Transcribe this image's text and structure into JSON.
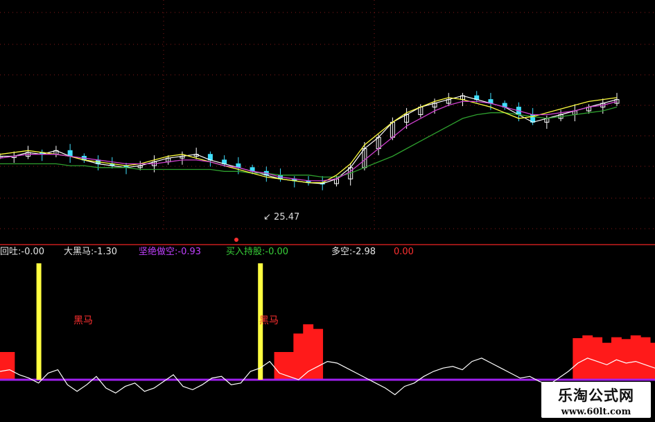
{
  "price_low_label": "25.47",
  "indicators": [
    {
      "label": "回吐:",
      "value": "-0.00",
      "color": "#e6e6e6"
    },
    {
      "label": "大黑马:",
      "value": "-1.30",
      "color": "#e6e6e6"
    },
    {
      "label": "坚绝做空:",
      "value": "-0.93",
      "color": "#c040ff"
    },
    {
      "label": "买入持股:",
      "value": "-0.00",
      "color": "#38d038"
    },
    {
      "label": "多空:",
      "value": "-2.98",
      "color": "#e6e6e6"
    },
    {
      "label": "",
      "value": "0.00",
      "color": "#ff3030"
    }
  ],
  "markers": [
    {
      "text": "黑马"
    },
    {
      "text": "黑马"
    }
  ],
  "watermark": {
    "text": "乐淘公式网",
    "url": "www.60lt.com"
  },
  "colors": {
    "bg": "#000000",
    "red": "#ff1a1a",
    "yellow": "#ffff40",
    "purple": "#a020f0",
    "green": "#2ea02e",
    "grid": "#8a1a1a"
  },
  "chart_data": [
    {
      "type": "line",
      "subtype": "candlestick-with-moving-averages",
      "title": "",
      "annotations": [
        "25.47"
      ],
      "grid": true,
      "series": [
        {
          "values": [
            40,
            40,
            42,
            41,
            43,
            40,
            38,
            36,
            35,
            34,
            35,
            37,
            39,
            40,
            41,
            38,
            36,
            34,
            32,
            30,
            28,
            27,
            26,
            25.5,
            28,
            34,
            44,
            50,
            58,
            62,
            66,
            68,
            70,
            72,
            70,
            68,
            66,
            62,
            58,
            60,
            62,
            64,
            66,
            68,
            70
          ]
        },
        {
          "values": [
            36,
            36,
            36,
            36,
            36,
            35,
            35,
            34,
            34,
            34,
            33,
            33,
            33,
            33,
            33,
            33,
            32,
            32,
            31,
            31,
            30,
            30,
            30,
            29,
            29,
            31,
            34,
            37,
            40,
            44,
            48,
            52,
            56,
            60,
            62,
            63,
            63,
            62,
            61,
            60,
            61,
            62,
            63,
            64,
            66
          ]
        },
        {
          "values": [
            41,
            42,
            43,
            42,
            41,
            40,
            38,
            37,
            36,
            35,
            36,
            38,
            40,
            41,
            39,
            37,
            35,
            33,
            31,
            29,
            28,
            27,
            26,
            26,
            30,
            36,
            46,
            52,
            58,
            63,
            66,
            69,
            71,
            70,
            68,
            66,
            63,
            60,
            61,
            63,
            65,
            67,
            69,
            70,
            71
          ]
        },
        {
          "values": [
            39,
            40,
            41,
            41,
            41,
            40,
            39,
            38,
            37,
            36,
            36,
            36,
            37,
            38,
            38,
            37,
            35,
            34,
            32,
            31,
            29,
            28,
            27,
            27,
            28,
            32,
            38,
            44,
            50,
            56,
            60,
            64,
            67,
            69,
            69,
            68,
            66,
            64,
            62,
            62,
            63,
            64,
            66,
            67,
            69
          ]
        }
      ]
    },
    {
      "type": "area",
      "title": "",
      "series": [
        {
          "values": [
            30,
            30,
            0,
            0,
            0,
            0,
            0,
            0,
            0,
            0,
            0,
            0,
            0,
            0,
            0,
            0,
            0,
            0,
            0,
            0,
            0,
            0,
            0,
            0,
            0,
            0,
            0,
            0,
            0,
            30,
            30,
            50,
            60,
            55,
            0,
            0,
            0,
            0,
            0,
            0,
            0,
            0,
            0,
            0,
            0,
            0,
            0,
            0,
            0,
            0,
            0,
            0,
            0,
            0,
            0,
            0,
            0,
            0,
            0,
            0,
            45,
            48,
            46,
            40,
            46,
            44,
            48,
            46,
            40
          ]
        },
        {
          "values": [
            0,
            0,
            0,
            0,
            100,
            0,
            0,
            0,
            0,
            0,
            0,
            0,
            0,
            0,
            0,
            0,
            0,
            0,
            0,
            0,
            0,
            0,
            0,
            0,
            0,
            0,
            0,
            100,
            0,
            0,
            0,
            0,
            0,
            0,
            0,
            0,
            0,
            0,
            0,
            0,
            0,
            0,
            0,
            0,
            0,
            0,
            0,
            0,
            0,
            0,
            0,
            0,
            0,
            0,
            0,
            0,
            0,
            0,
            0,
            0,
            0,
            0,
            0,
            0,
            0,
            0,
            0,
            0,
            0
          ]
        },
        {
          "values": [
            10,
            12,
            6,
            2,
            -4,
            8,
            12,
            -6,
            -14,
            -6,
            4,
            -10,
            -16,
            -8,
            -4,
            -14,
            -10,
            -2,
            6,
            -8,
            -12,
            -6,
            2,
            4,
            -6,
            -4,
            10,
            14,
            22,
            8,
            4,
            0,
            10,
            16,
            22,
            20,
            14,
            8,
            2,
            -4,
            -10,
            -18,
            -8,
            -4,
            4,
            10,
            14,
            16,
            12,
            22,
            26,
            20,
            14,
            8,
            2,
            4,
            -2,
            -6,
            2,
            10,
            20,
            26,
            22,
            18,
            24,
            20,
            22,
            18,
            14
          ]
        }
      ]
    }
  ]
}
